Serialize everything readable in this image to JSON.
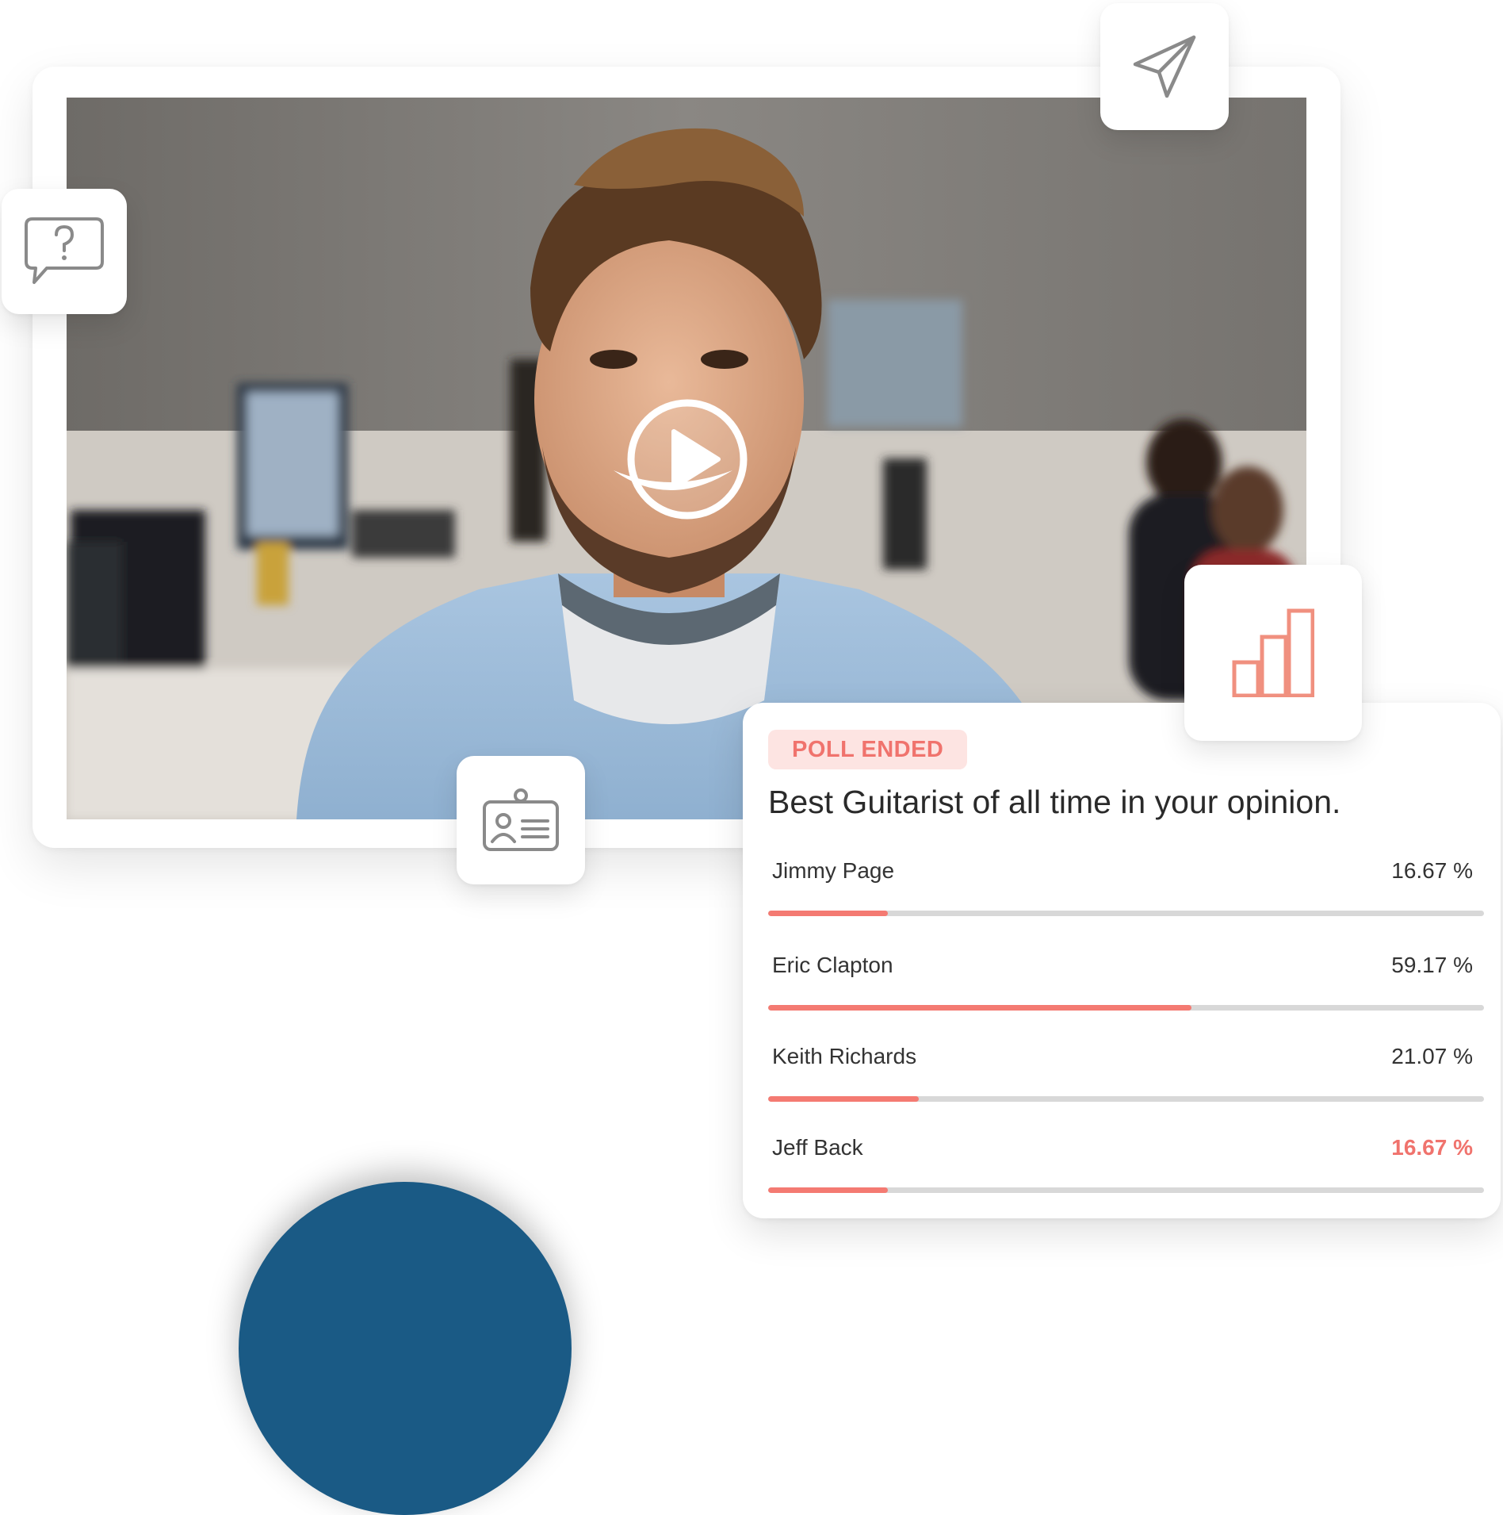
{
  "icons": {
    "send": "paper-plane-icon",
    "question": "question-chat-icon",
    "contact": "contact-card-icon",
    "chart": "bar-chart-icon",
    "play": "play-icon"
  },
  "colors": {
    "accent": "#f47a72",
    "accent_text": "#f0736d",
    "badge_bg": "#fde4e2",
    "track": "#d8d8d8",
    "icon_gray": "#8a8a8a",
    "deco_blue": "#1a5a85"
  },
  "poll": {
    "status": "POLL ENDED",
    "question": "Best Guitarist of all time in your opinion.",
    "options": [
      {
        "name": "Jimmy Page",
        "percent_label": "16.67 %",
        "percent": 16.67
      },
      {
        "name": "Eric Clapton",
        "percent_label": "59.17 %",
        "percent": 59.17
      },
      {
        "name": "Keith Richards",
        "percent_label": "21.07 %",
        "percent": 21.07
      },
      {
        "name": "Jeff Back",
        "percent_label": "16.67 %",
        "percent": 16.67
      }
    ]
  }
}
